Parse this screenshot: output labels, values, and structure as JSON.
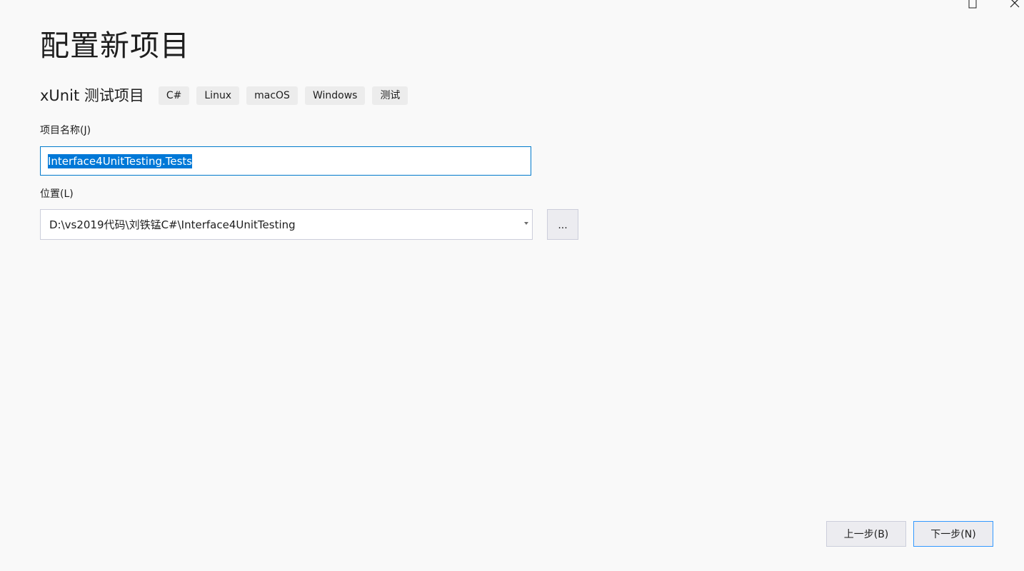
{
  "window": {
    "maximize_icon": "maximize-icon",
    "close_icon": "close-icon"
  },
  "header": {
    "title": "配置新项目"
  },
  "template": {
    "name": "xUnit 测试项目",
    "tags": [
      "C#",
      "Linux",
      "macOS",
      "Windows",
      "测试"
    ]
  },
  "form": {
    "project_name_label": "项目名称(J)",
    "project_name_value": "Interface4UnitTesting.Tests",
    "location_label": "位置(L)",
    "location_value": "D:\\vs2019代码\\刘铁锰C#\\Interface4UnitTesting",
    "browse_label": "..."
  },
  "footer": {
    "back_label": "上一步(B)",
    "next_label": "下一步(N)"
  },
  "colors": {
    "background": "#f9f9f9",
    "focus_border": "#007acc",
    "selection": "#0078d7",
    "default_button_border": "#3399ff",
    "tag_background": "#ececec"
  }
}
